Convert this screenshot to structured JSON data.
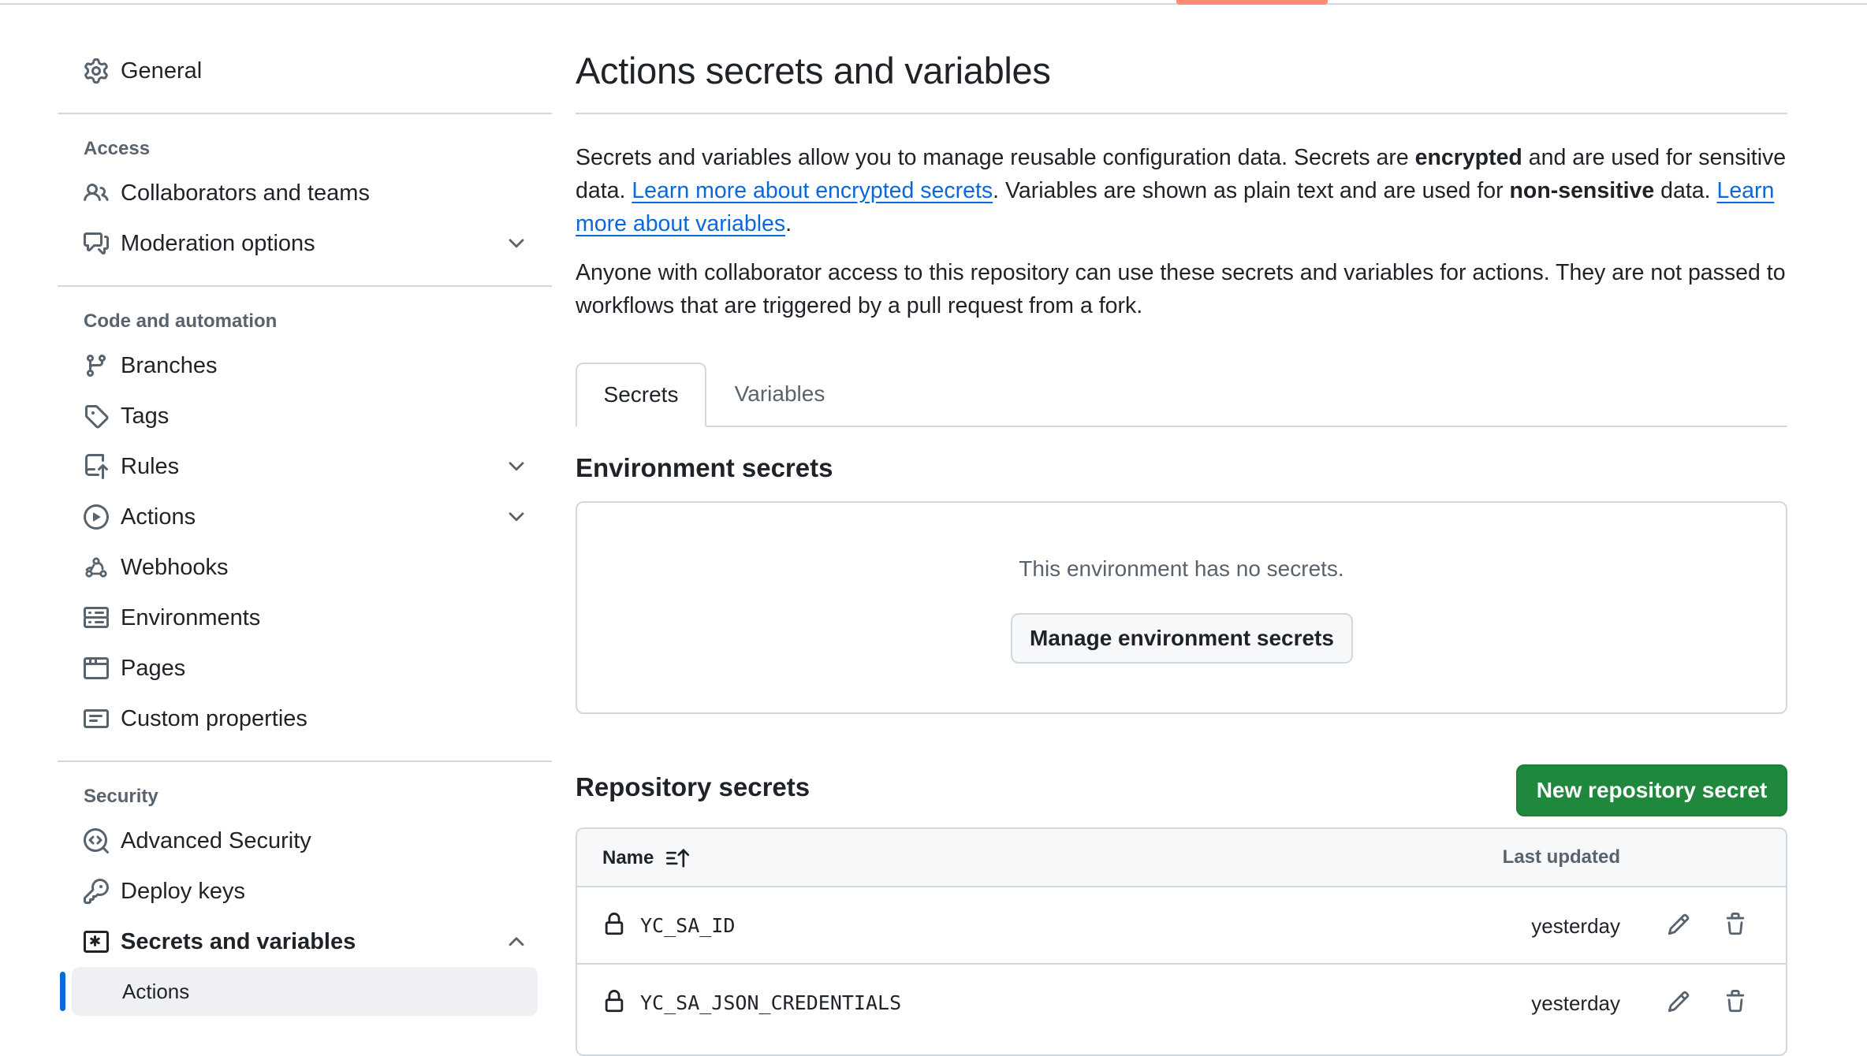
{
  "colors": {
    "accent": "#0969da",
    "primary_button": "#1f883d",
    "tab_underline": "#fd8c73"
  },
  "sidebar": {
    "general": {
      "label": "General",
      "icon": "gear-icon"
    },
    "groups": [
      {
        "title": "Access",
        "items": [
          {
            "label": "Collaborators and teams",
            "icon": "people-icon",
            "expandable": false
          },
          {
            "label": "Moderation options",
            "icon": "comment-discussion-icon",
            "expandable": true
          }
        ]
      },
      {
        "title": "Code and automation",
        "items": [
          {
            "label": "Branches",
            "icon": "git-branch-icon",
            "expandable": false
          },
          {
            "label": "Tags",
            "icon": "tag-icon",
            "expandable": false
          },
          {
            "label": "Rules",
            "icon": "repo-push-icon",
            "expandable": true
          },
          {
            "label": "Actions",
            "icon": "play-icon",
            "expandable": true
          },
          {
            "label": "Webhooks",
            "icon": "webhook-icon",
            "expandable": false
          },
          {
            "label": "Environments",
            "icon": "server-icon",
            "expandable": false
          },
          {
            "label": "Pages",
            "icon": "browser-icon",
            "expandable": false
          },
          {
            "label": "Custom properties",
            "icon": "note-icon",
            "expandable": false
          }
        ]
      },
      {
        "title": "Security",
        "items": [
          {
            "label": "Advanced Security",
            "icon": "codescan-icon",
            "expandable": false
          },
          {
            "label": "Deploy keys",
            "icon": "key-icon",
            "expandable": false
          },
          {
            "label": "Secrets and variables",
            "icon": "key-asterisk-icon",
            "expandable": true,
            "expanded": true
          }
        ],
        "subitems": [
          {
            "label": "Actions",
            "active": true
          }
        ]
      }
    ]
  },
  "main": {
    "title": "Actions secrets and variables",
    "intro": {
      "t1": "Secrets and variables allow you to manage reusable configuration data. Secrets are ",
      "b1": "encrypted",
      "t2": " and are used for sensitive data. ",
      "link1": "Learn more about encrypted secrets",
      "t3": ". Variables are shown as plain text and are used for ",
      "b2": "non-sensitive",
      "t4": " data. ",
      "link2": "Learn more about variables",
      "t5": "."
    },
    "notice": "Anyone with collaborator access to this repository can use these secrets and variables for actions. They are not passed to workflows that are triggered by a pull request from a fork.",
    "tabs": [
      {
        "label": "Secrets",
        "active": true
      },
      {
        "label": "Variables",
        "active": false
      }
    ],
    "environment": {
      "title": "Environment secrets",
      "empty_text": "This environment has no secrets.",
      "manage_button": "Manage environment secrets"
    },
    "repository": {
      "title": "Repository secrets",
      "new_button": "New repository secret",
      "columns": {
        "name": "Name",
        "last_updated": "Last updated"
      },
      "rows": [
        {
          "name": "YC_SA_ID",
          "updated": "yesterday"
        },
        {
          "name": "YC_SA_JSON_CREDENTIALS",
          "updated": "yesterday"
        }
      ]
    }
  }
}
